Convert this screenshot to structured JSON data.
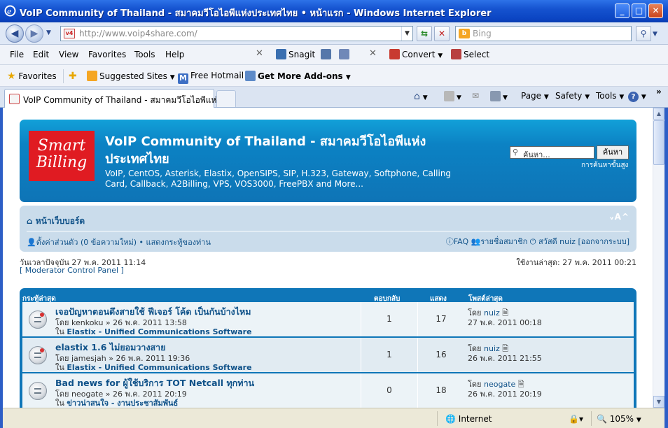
{
  "window": {
    "title": "VoIP Community of Thailand - สมาคมวีโอไอพีแห่งประเทศไทย • หน้าแรก - Windows Internet Explorer",
    "minimize": "_",
    "maximize": "□",
    "close": "✕"
  },
  "address": {
    "url": "http://www.voip4share.com/",
    "search_placeholder": "Bing"
  },
  "menu": [
    "File",
    "Edit",
    "View",
    "Favorites",
    "Tools",
    "Help"
  ],
  "toolbar": {
    "snagit": "Snagit",
    "convert": "Convert",
    "select": "Select"
  },
  "favbar": {
    "favorites": "Favorites",
    "suggested": "Suggested Sites",
    "hotmail": "Free Hotmail",
    "addons": "Get More Add-ons"
  },
  "tab": {
    "title": "VoIP Community of Thailand - สมาคมวีโอไอพีแห่...",
    "page": "Page",
    "safety": "Safety",
    "tools": "Tools"
  },
  "site": {
    "logo_line1": "Smart",
    "logo_line2": "Billing",
    "title": "VoIP Community of Thailand - สมาคมวีโอไอพีแห่งประเทศไทย",
    "description": "VoIP, CentOS, Asterisk, Elastix, OpenSIPS, SIP, H.323, Gateway, Softphone, Calling Card, Callback, A2Billing, VPS, VOS3000, FreePBX and More...",
    "search_placeholder": "ค้นหา...",
    "search_button": "ค้นหา",
    "advanced_search": "การค้นหาขั้นสูง"
  },
  "navbar": {
    "home": "หน้าเว็บบอร์ด",
    "font_size": "ᵥA^",
    "ucp": "ตั้งค่าส่วนตัว (0 ข้อความใหม่) • แสดงกระทู้ของท่าน",
    "faq": "FAQ",
    "members": "รายชื่อสมาชิก",
    "greeting": "สวัสดี nuiz",
    "logout": "[ออกจากระบบ]"
  },
  "info": {
    "current_time": "วันเวลาปัจจุบัน 27 พ.ค. 2011 11:14",
    "mcp": "[ Moderator Control Panel ]",
    "last_visit": "ใช้งานล่าสุด: 27 พ.ค. 2011 00:21"
  },
  "topics": {
    "headers": {
      "title": "กระทู้ล่าสุด",
      "replies": "ตอบกลับ",
      "views": "แสดง",
      "last_post": "โพสต์ล่าสุด"
    },
    "rows": [
      {
        "title": "เจอปัญหาตอนดึงสายใช้ ฟีเจอร์ โค้ด เป็นกันบ้างไหม",
        "by": "โดย kenkoku » 26 พ.ค. 2011 13:58",
        "in_prefix": "ใน",
        "forum": "Elastix - Unified Communications Software",
        "replies": "1",
        "views": "17",
        "last_by_prefix": "โดย",
        "last_user": "nuiz",
        "last_time": "27 พ.ค. 2011 00:18"
      },
      {
        "title": "elastix 1.6 ไม่ยอมวางสาย",
        "by": "โดย jamesjah » 26 พ.ค. 2011 19:36",
        "in_prefix": "ใน",
        "forum": "Elastix - Unified Communications Software",
        "replies": "1",
        "views": "16",
        "last_by_prefix": "โดย",
        "last_user": "nuiz",
        "last_time": "26 พ.ค. 2011 21:55"
      },
      {
        "title": "Bad news for ผู้ใช้บริการ TOT Netcall ทุกท่าน",
        "by": "โดย neogate » 26 พ.ค. 2011 20:19",
        "in_prefix": "ใน",
        "forum": "ข่าวน่าสนใจ - งานประชาสัมพันธ์",
        "replies": "0",
        "views": "18",
        "last_by_prefix": "โดย",
        "last_user": "neogate",
        "last_time": "26 พ.ค. 2011 20:19"
      }
    ]
  },
  "status": {
    "zone": "Internet",
    "zoom": "105%"
  }
}
